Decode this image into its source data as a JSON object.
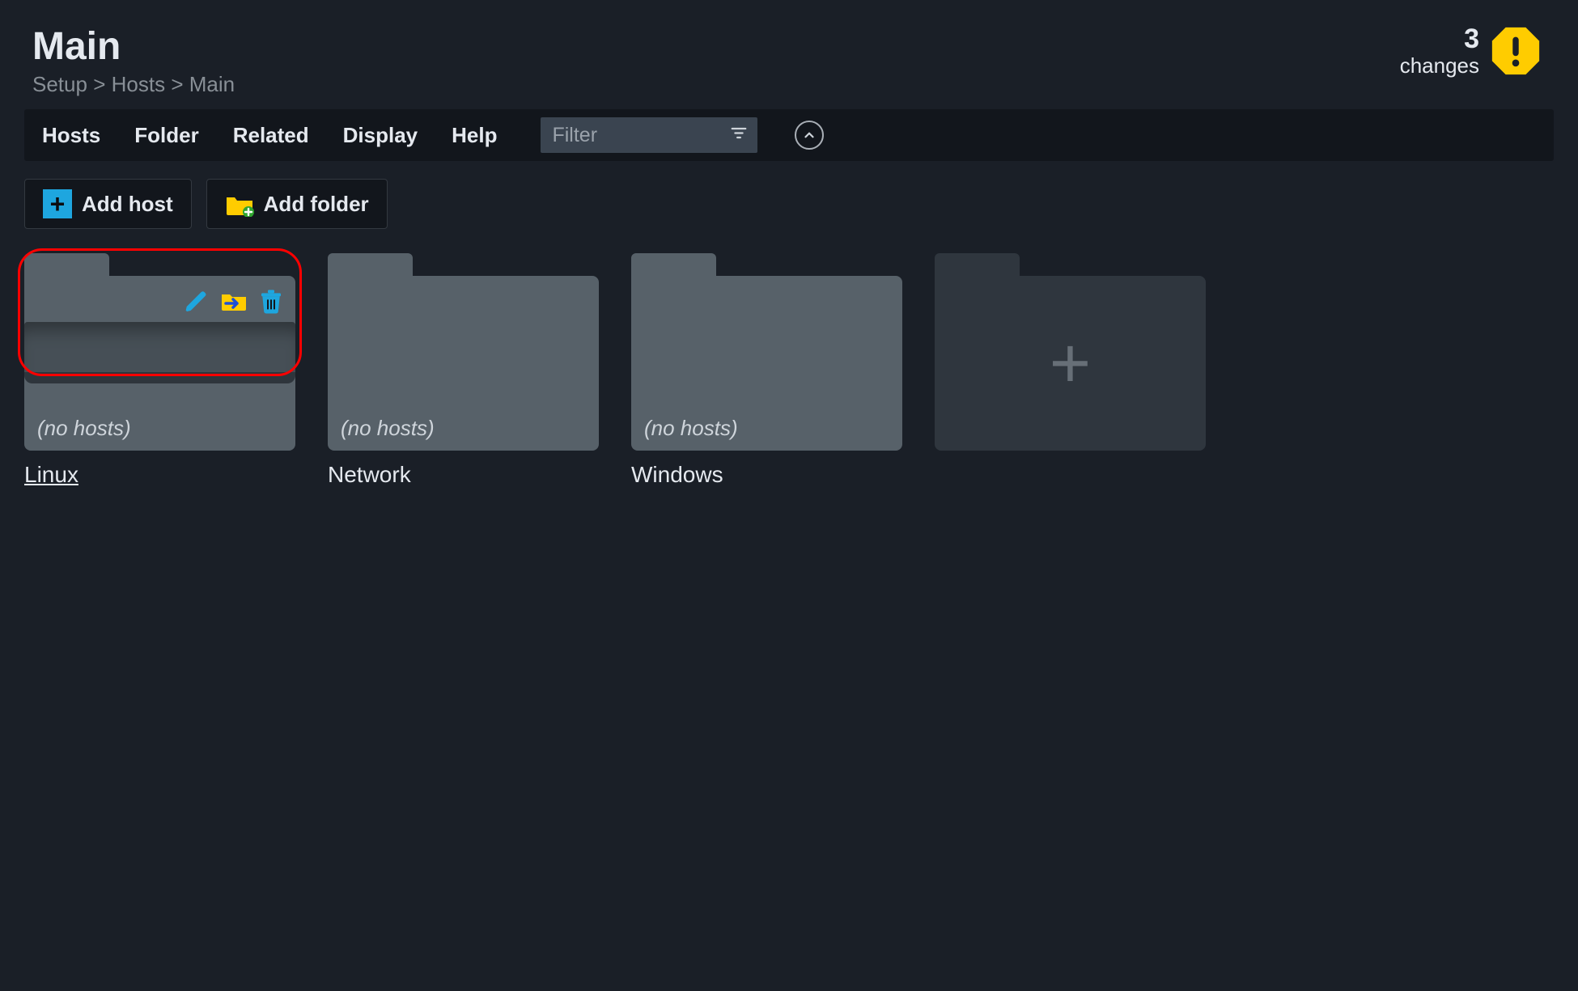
{
  "page": {
    "title": "Main"
  },
  "breadcrumb": [
    "Setup",
    "Hosts",
    "Main"
  ],
  "changes": {
    "count": "3",
    "label": "changes"
  },
  "menu": {
    "hosts": "Hosts",
    "folder": "Folder",
    "related": "Related",
    "display": "Display",
    "help": "Help"
  },
  "filter": {
    "placeholder": "Filter",
    "value": ""
  },
  "actions": {
    "add_host": "Add host",
    "add_folder": "Add folder"
  },
  "folders": [
    {
      "name": "Linux",
      "empty_text": "(no hosts)",
      "hovered": true,
      "underline": true
    },
    {
      "name": "Network",
      "empty_text": "(no hosts)",
      "hovered": false,
      "underline": false
    },
    {
      "name": "Windows",
      "empty_text": "(no hosts)",
      "hovered": false,
      "underline": false
    }
  ],
  "hover_actions": {
    "edit": "edit-icon",
    "move": "move-to-folder-icon",
    "delete": "trash-icon"
  }
}
